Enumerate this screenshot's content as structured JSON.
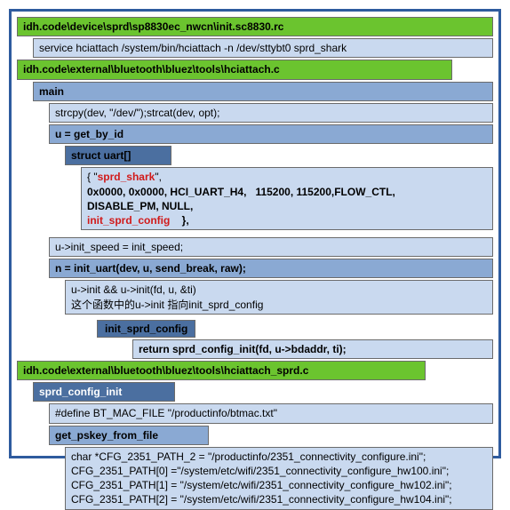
{
  "file1": {
    "path": "idh.code\\device\\sprd\\sp8830ec_nwcn\\init.sc8830.rc",
    "service": "service hciattach /system/bin/hciattach -n /dev/sttybt0 sprd_shark"
  },
  "file2": {
    "path": "idh.code\\external\\bluetooth\\bluez\\tools\\hciattach.c",
    "main": "main",
    "strcpy": "strcpy(dev, \"/dev/\");strcat(dev, opt);",
    "get_by_id": "u = get_by_id",
    "struct": "struct uart[]",
    "entry_open": "{ \"",
    "entry_key": "sprd_shark",
    "entry_close": "\",",
    "entry_line2": "0x0000, 0x0000, HCI_UART_H4,   115200, 115200,FLOW_CTL,",
    "entry_line3": "DISABLE_PM, NULL,",
    "entry_init": "init_sprd_config",
    "entry_end": "    },",
    "init_speed": "u->init_speed = init_speed;",
    "init_uart": "n = init_uart(dev, u, send_break, raw);",
    "uinit": "u->init && u->init(fd, u, &ti)",
    "uinit_note": "这个函数中的u->init 指向init_sprd_config",
    "init_sprd_config": "init_sprd_config",
    "return": "return sprd_config_init(fd, u->bdaddr, ti);"
  },
  "file3": {
    "path": "idh.code\\external\\bluetooth\\bluez\\tools\\hciattach_sprd.c",
    "func": "sprd_config_init",
    "define": "#define BT_MAC_FILE                  \"/productinfo/btmac.txt\"",
    "getpskey": "get_pskey_from_file",
    "cfg0": "char *CFG_2351_PATH_2 = \"/productinfo/2351_connectivity_configure.ini\";",
    "cfg1": "CFG_2351_PATH[0] =\"/system/etc/wifi/2351_connectivity_configure_hw100.ini\";",
    "cfg2": "CFG_2351_PATH[1] = \"/system/etc/wifi/2351_connectivity_configure_hw102.ini\";",
    "cfg3": "CFG_2351_PATH[2] = \"/system/etc/wifi/2351_connectivity_configure_hw104.ini\";"
  }
}
